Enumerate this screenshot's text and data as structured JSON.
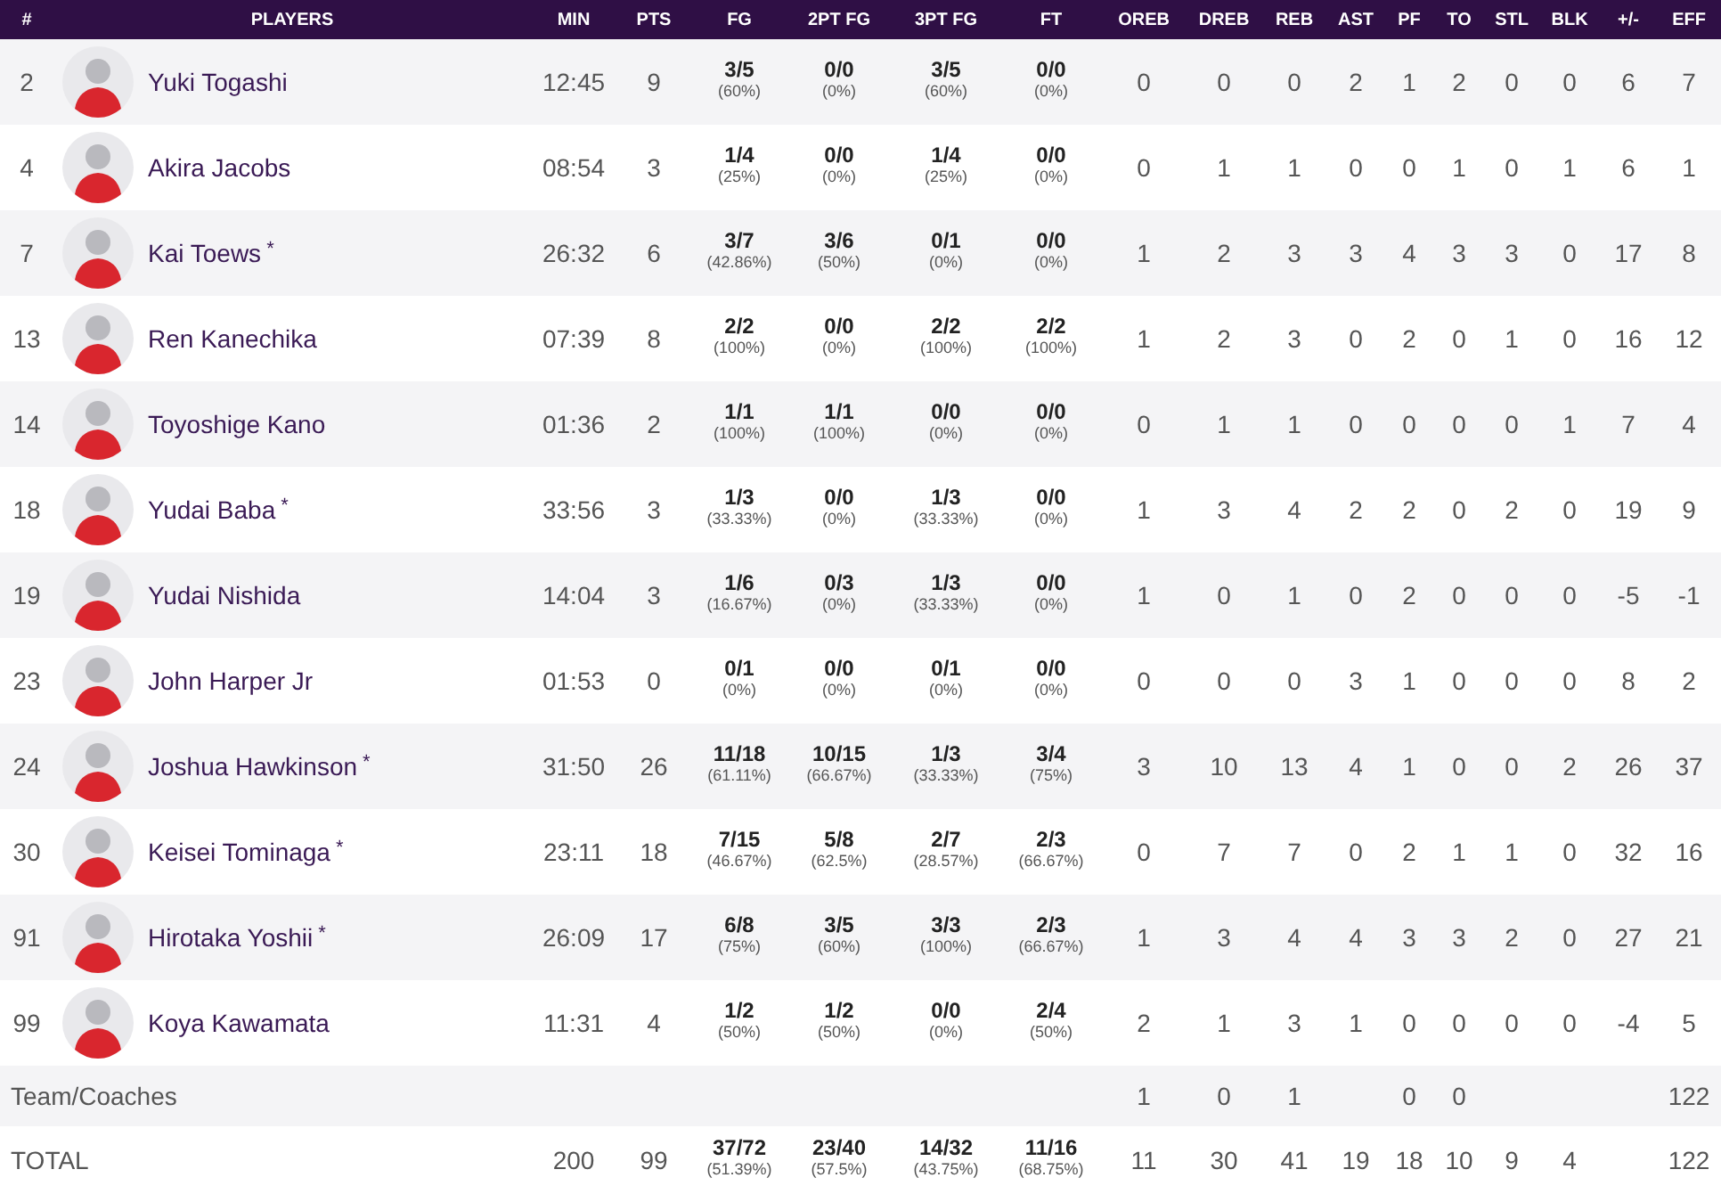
{
  "columns": [
    "#",
    "PLAYERS",
    "MIN",
    "PTS",
    "FG",
    "2PT FG",
    "3PT FG",
    "FT",
    "OREB",
    "DREB",
    "REB",
    "AST",
    "PF",
    "TO",
    "STL",
    "BLK",
    "+/-",
    "EFF"
  ],
  "players": [
    {
      "number": "2",
      "name": "Yuki Togashi",
      "line": [
        "12:45",
        "9"
      ],
      "shooting": [
        [
          "3/5",
          "(60%)"
        ],
        [
          "0/0",
          "(0%)"
        ],
        [
          "3/5",
          "(60%)"
        ],
        [
          "0/0",
          "(0%)"
        ]
      ],
      "stats": [
        "0",
        "0",
        "0",
        "2",
        "1",
        "2",
        "0",
        "0",
        "6",
        "7"
      ]
    },
    {
      "number": "4",
      "name": "Akira Jacobs",
      "line": [
        "08:54",
        "3"
      ],
      "shooting": [
        [
          "1/4",
          "(25%)"
        ],
        [
          "0/0",
          "(0%)"
        ],
        [
          "1/4",
          "(25%)"
        ],
        [
          "0/0",
          "(0%)"
        ]
      ],
      "stats": [
        "0",
        "1",
        "1",
        "0",
        "0",
        "1",
        "0",
        "1",
        "6",
        "1"
      ]
    },
    {
      "number": "7",
      "name": "Kai Toews",
      "mark": "*",
      "line": [
        "26:32",
        "6"
      ],
      "shooting": [
        [
          "3/7",
          "(42.86%)"
        ],
        [
          "3/6",
          "(50%)"
        ],
        [
          "0/1",
          "(0%)"
        ],
        [
          "0/0",
          "(0%)"
        ]
      ],
      "stats": [
        "1",
        "2",
        "3",
        "3",
        "4",
        "3",
        "3",
        "0",
        "17",
        "8"
      ]
    },
    {
      "number": "13",
      "name": "Ren Kanechika",
      "line": [
        "07:39",
        "8"
      ],
      "shooting": [
        [
          "2/2",
          "(100%)"
        ],
        [
          "0/0",
          "(0%)"
        ],
        [
          "2/2",
          "(100%)"
        ],
        [
          "2/2",
          "(100%)"
        ]
      ],
      "stats": [
        "1",
        "2",
        "3",
        "0",
        "2",
        "0",
        "1",
        "0",
        "16",
        "12"
      ]
    },
    {
      "number": "14",
      "name": "Toyoshige Kano",
      "line": [
        "01:36",
        "2"
      ],
      "shooting": [
        [
          "1/1",
          "(100%)"
        ],
        [
          "1/1",
          "(100%)"
        ],
        [
          "0/0",
          "(0%)"
        ],
        [
          "0/0",
          "(0%)"
        ]
      ],
      "stats": [
        "0",
        "1",
        "1",
        "0",
        "0",
        "0",
        "0",
        "1",
        "7",
        "4"
      ]
    },
    {
      "number": "18",
      "name": "Yudai Baba",
      "mark": "*",
      "line": [
        "33:56",
        "3"
      ],
      "shooting": [
        [
          "1/3",
          "(33.33%)"
        ],
        [
          "0/0",
          "(0%)"
        ],
        [
          "1/3",
          "(33.33%)"
        ],
        [
          "0/0",
          "(0%)"
        ]
      ],
      "stats": [
        "1",
        "3",
        "4",
        "2",
        "2",
        "0",
        "2",
        "0",
        "19",
        "9"
      ]
    },
    {
      "number": "19",
      "name": "Yudai Nishida",
      "line": [
        "14:04",
        "3"
      ],
      "shooting": [
        [
          "1/6",
          "(16.67%)"
        ],
        [
          "0/3",
          "(0%)"
        ],
        [
          "1/3",
          "(33.33%)"
        ],
        [
          "0/0",
          "(0%)"
        ]
      ],
      "stats": [
        "1",
        "0",
        "1",
        "0",
        "2",
        "0",
        "0",
        "0",
        "-5",
        "-1"
      ]
    },
    {
      "number": "23",
      "name": "John Harper Jr",
      "line": [
        "01:53",
        "0"
      ],
      "shooting": [
        [
          "0/1",
          "(0%)"
        ],
        [
          "0/0",
          "(0%)"
        ],
        [
          "0/1",
          "(0%)"
        ],
        [
          "0/0",
          "(0%)"
        ]
      ],
      "stats": [
        "0",
        "0",
        "0",
        "3",
        "1",
        "0",
        "0",
        "0",
        "8",
        "2"
      ]
    },
    {
      "number": "24",
      "name": "Joshua Hawkinson",
      "mark": "*",
      "line": [
        "31:50",
        "26"
      ],
      "shooting": [
        [
          "11/18",
          "(61.11%)"
        ],
        [
          "10/15",
          "(66.67%)"
        ],
        [
          "1/3",
          "(33.33%)"
        ],
        [
          "3/4",
          "(75%)"
        ]
      ],
      "stats": [
        "3",
        "10",
        "13",
        "4",
        "1",
        "0",
        "0",
        "2",
        "26",
        "37"
      ]
    },
    {
      "number": "30",
      "name": "Keisei Tominaga",
      "mark": "*",
      "line": [
        "23:11",
        "18"
      ],
      "shooting": [
        [
          "7/15",
          "(46.67%)"
        ],
        [
          "5/8",
          "(62.5%)"
        ],
        [
          "2/7",
          "(28.57%)"
        ],
        [
          "2/3",
          "(66.67%)"
        ]
      ],
      "stats": [
        "0",
        "7",
        "7",
        "0",
        "2",
        "1",
        "1",
        "0",
        "32",
        "16"
      ]
    },
    {
      "number": "91",
      "name": "Hirotaka Yoshii",
      "mark": "*",
      "line": [
        "26:09",
        "17"
      ],
      "shooting": [
        [
          "6/8",
          "(75%)"
        ],
        [
          "3/5",
          "(60%)"
        ],
        [
          "3/3",
          "(100%)"
        ],
        [
          "2/3",
          "(66.67%)"
        ]
      ],
      "stats": [
        "1",
        "3",
        "4",
        "4",
        "3",
        "3",
        "2",
        "0",
        "27",
        "21"
      ]
    },
    {
      "number": "99",
      "name": "Koya Kawamata",
      "line": [
        "11:31",
        "4"
      ],
      "shooting": [
        [
          "1/2",
          "(50%)"
        ],
        [
          "1/2",
          "(50%)"
        ],
        [
          "0/0",
          "(0%)"
        ],
        [
          "2/4",
          "(50%)"
        ]
      ],
      "stats": [
        "2",
        "1",
        "3",
        "1",
        "0",
        "0",
        "0",
        "0",
        "-4",
        "5"
      ]
    }
  ],
  "summary": [
    {
      "label": "Team/Coaches",
      "stats_by_column": {
        "oreb": "1",
        "dreb": "0",
        "reb": "1",
        "pf": "0",
        "to": "0",
        "eff": "122"
      }
    },
    {
      "label": "TOTAL",
      "line": [
        "200",
        "99"
      ],
      "shooting": [
        [
          "37/72",
          "(51.39%)"
        ],
        [
          "23/40",
          "(57.5%)"
        ],
        [
          "14/32",
          "(43.75%)"
        ],
        [
          "11/16",
          "(68.75%)"
        ]
      ],
      "stats_by_column": {
        "oreb": "11",
        "dreb": "30",
        "reb": "41",
        "ast": "19",
        "pf": "18",
        "to": "10",
        "stl": "9",
        "blk": "4",
        "eff": "122"
      }
    }
  ]
}
